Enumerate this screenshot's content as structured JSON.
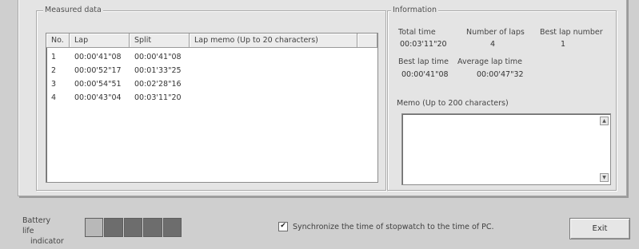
{
  "measured": {
    "title": "Measured data",
    "columns": [
      "No.",
      "Lap",
      "Split",
      "Lap memo (Up to 20 characters)"
    ],
    "rows": [
      {
        "no": "1",
        "lap": "00:00'41\"08",
        "split": "00:00'41\"08",
        "memo": ""
      },
      {
        "no": "2",
        "lap": "00:00'52\"17",
        "split": "00:01'33\"25",
        "memo": ""
      },
      {
        "no": "3",
        "lap": "00:00'54\"51",
        "split": "00:02'28\"16",
        "memo": ""
      },
      {
        "no": "4",
        "lap": "00:00'43\"04",
        "split": "00:03'11\"20",
        "memo": ""
      }
    ]
  },
  "info": {
    "title": "Information",
    "total_time_label": "Total time",
    "total_time": "00:03'11\"20",
    "laps_label": "Number of laps",
    "laps": "4",
    "best_lap_no_label": "Best lap number",
    "best_lap_no": "1",
    "best_lap_time_label": "Best lap time",
    "best_lap_time": "00:00'41\"08",
    "avg_lap_label": "Average lap time",
    "avg_lap": "00:00'47\"32",
    "memo_label": "Memo (Up to 200 characters)",
    "memo_value": ""
  },
  "footer": {
    "battery_label_1": "Battery life",
    "battery_label_2": "indicator",
    "battery_segments": [
      "light",
      "dark",
      "dark",
      "dark",
      "dark"
    ],
    "sync_checked": true,
    "sync_label": "Synchronize the time of stopwatch to the time of PC.",
    "exit_label": "Exit"
  }
}
